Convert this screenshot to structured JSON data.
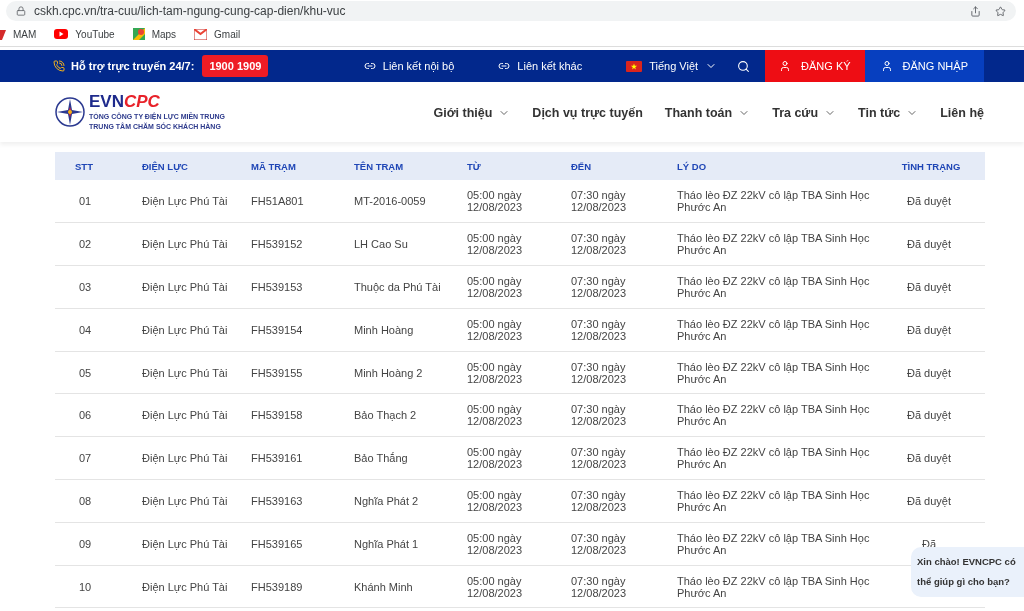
{
  "browser": {
    "url": "cskh.cpc.vn/tra-cuu/lich-tam-ngung-cung-cap-dien/khu-vuc",
    "bookmarks": [
      {
        "label": "MAM",
        "kind": "mam"
      },
      {
        "label": "YouTube",
        "kind": "youtube"
      },
      {
        "label": "Maps",
        "kind": "maps"
      },
      {
        "label": "Gmail",
        "kind": "gmail"
      }
    ]
  },
  "topbar": {
    "support_label": "Hỗ trợ trực truyến 24/7:",
    "hotline": "1900 1909",
    "links": [
      "Liên kết nội bộ",
      "Liên kết khác"
    ],
    "language": "Tiếng Việt",
    "register": "ĐĂNG KÝ",
    "login": "ĐĂNG NHẬP"
  },
  "logo": {
    "brand_main": "EVN",
    "brand_accent": "CPC",
    "line_1": "TỔNG CÔNG TY ĐIỆN LỰC MIỀN TRUNG",
    "line_2": "TRUNG TÂM CHĂM SÓC KHÁCH HÀNG"
  },
  "nav": [
    {
      "label": "Giới thiệu",
      "dropdown": true
    },
    {
      "label": "Dịch vụ trực tuyến",
      "dropdown": false
    },
    {
      "label": "Thanh toán",
      "dropdown": true
    },
    {
      "label": "Tra cứu",
      "dropdown": true
    },
    {
      "label": "Tin tức",
      "dropdown": true
    },
    {
      "label": "Liên hệ",
      "dropdown": false
    }
  ],
  "table": {
    "columns": [
      "STT",
      "ĐIỆN LỰC",
      "MÃ TRẠM",
      "TÊN TRẠM",
      "TỪ",
      "ĐẾN",
      "LÝ DO",
      "TÌNH TRẠNG"
    ],
    "rows": [
      [
        "01",
        "Điện Lực Phú Tài",
        "FH51A801",
        "MT-2016-0059",
        "05:00 ngày 12/08/2023",
        "07:30 ngày 12/08/2023",
        "Tháo lèo ĐZ 22kV cô lập TBA Sinh Học Phước An",
        "Đã duyệt"
      ],
      [
        "02",
        "Điện Lực Phú Tài",
        "FH539152",
        "LH Cao Su",
        "05:00 ngày 12/08/2023",
        "07:30 ngày 12/08/2023",
        "Tháo lèo ĐZ 22kV cô lập TBA Sinh Học Phước An",
        "Đã duyệt"
      ],
      [
        "03",
        "Điện Lực Phú Tài",
        "FH539153",
        "Thuộc da Phú Tài",
        "05:00 ngày 12/08/2023",
        "07:30 ngày 12/08/2023",
        "Tháo lèo ĐZ 22kV cô lập TBA Sinh Học Phước An",
        "Đã duyệt"
      ],
      [
        "04",
        "Điện Lực Phú Tài",
        "FH539154",
        "Minh Hoàng",
        "05:00 ngày 12/08/2023",
        "07:30 ngày 12/08/2023",
        "Tháo lèo ĐZ 22kV cô lập TBA Sinh Học Phước An",
        "Đã duyệt"
      ],
      [
        "05",
        "Điện Lực Phú Tài",
        "FH539155",
        "Minh Hoàng 2",
        "05:00 ngày 12/08/2023",
        "07:30 ngày 12/08/2023",
        "Tháo lèo ĐZ 22kV cô lập TBA Sinh Học Phước An",
        "Đã duyệt"
      ],
      [
        "06",
        "Điện Lực Phú Tài",
        "FH539158",
        "Bảo Thạch 2",
        "05:00 ngày 12/08/2023",
        "07:30 ngày 12/08/2023",
        "Tháo lèo ĐZ 22kV cô lập TBA Sinh Học Phước An",
        "Đã duyệt"
      ],
      [
        "07",
        "Điện Lực Phú Tài",
        "FH539161",
        "Bảo Thắng",
        "05:00 ngày 12/08/2023",
        "07:30 ngày 12/08/2023",
        "Tháo lèo ĐZ 22kV cô lập TBA Sinh Học Phước An",
        "Đã duyệt"
      ],
      [
        "08",
        "Điện Lực Phú Tài",
        "FH539163",
        "Nghĩa Phát 2",
        "05:00 ngày 12/08/2023",
        "07:30 ngày 12/08/2023",
        "Tháo lèo ĐZ 22kV cô lập TBA Sinh Học Phước An",
        "Đã duyệt"
      ],
      [
        "09",
        "Điện Lực Phú Tài",
        "FH539165",
        "Nghĩa Phát 1",
        "05:00 ngày 12/08/2023",
        "07:30 ngày 12/08/2023",
        "Tháo lèo ĐZ 22kV cô lập TBA Sinh Học Phước An",
        "Đã"
      ],
      [
        "10",
        "Điện Lực Phú Tài",
        "FH539189",
        "Khánh Minh",
        "05:00 ngày 12/08/2023",
        "07:30 ngày 12/08/2023",
        "Tháo lèo ĐZ 22kV cô lập TBA Sinh Học Phước An"
      ]
    ]
  },
  "chat_bubble": {
    "text": "Xin chào! EVNCPC có thể giúp gì cho bạn?"
  }
}
